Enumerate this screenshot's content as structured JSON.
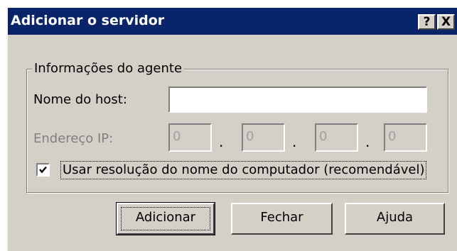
{
  "window": {
    "title": "Adicionar o servidor",
    "help_button": "?",
    "close_button": "X"
  },
  "agent_group": {
    "legend": "Informações do agente",
    "host_label": "Nome do host:",
    "host_value": "",
    "ip_label": "Endereço IP:",
    "ip_octets": [
      "0",
      "0",
      "0",
      "0"
    ],
    "ip_separator": ".",
    "use_dns_label": "Usar resolução do nome do computador (recomendável)",
    "use_dns_checked": true
  },
  "buttons": {
    "add": "Adicionar",
    "close": "Fechar",
    "help": "Ajuda"
  },
  "colors": {
    "titlebar": "#0a246a",
    "face": "#d4d0c8",
    "disabled_text": "#808080"
  }
}
